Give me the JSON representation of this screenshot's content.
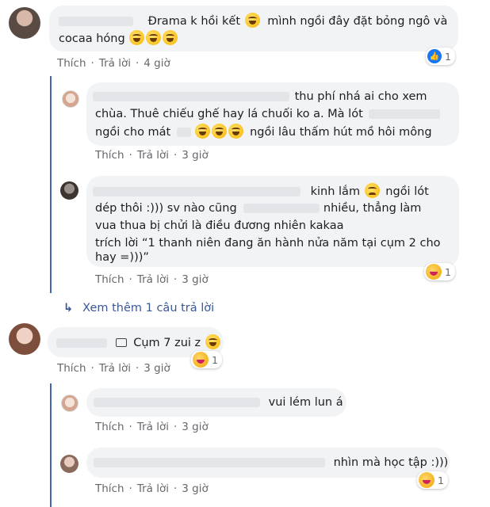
{
  "comments": [
    {
      "id": "c1",
      "lines": [
        "Đrama k hồi kết",
        "mình ngồi đây đặt bỏng ngô và",
        "cocaa hóng"
      ],
      "action_like": "Thích",
      "action_reply": "Trả lời",
      "time": "4 giờ",
      "reaction_count": "1",
      "reaction_icon": "like-icon"
    },
    {
      "id": "c1r1",
      "lines": [
        "thu phí nhá ai cho xem",
        "chùa. Thuê chiếu ghế hay lá chuối ko a. Mà lót",
        "ngồi cho mát",
        "ngồi lâu thấm hút mồ hôi mông"
      ],
      "action_like": "Thích",
      "action_reply": "Trả lời",
      "time": "3 giờ"
    },
    {
      "id": "c1r2",
      "lines": [
        "kinh lắm",
        "ngồi lót",
        "dép thôi :))) sv nào cũng",
        "nhiều, thẳng làm",
        "vua thua bị chửi là điều đương nhiên kakaa",
        "trích lời “1 thanh niên đang ăn hành nửa năm tại cụm 2 cho",
        "hay =)))”"
      ],
      "action_like": "Thích",
      "action_reply": "Trả lời",
      "time": "3 giờ",
      "reaction_count": "1",
      "reaction_icon": "haha-icon"
    },
    {
      "id": "c2",
      "lines": [
        "Cụm 7 zui z"
      ],
      "action_like": "Thích",
      "action_reply": "Trả lời",
      "time": "3 giờ",
      "reaction_count": "1",
      "reaction_icon": "haha-icon"
    },
    {
      "id": "c2r1",
      "lines": [
        "vui lém lun á"
      ],
      "action_like": "Thích",
      "action_reply": "Trả lời",
      "time": "3 giờ"
    },
    {
      "id": "c2r2",
      "lines": [
        "nhìn mà học tập :)))"
      ],
      "action_like": "Thích",
      "action_reply": "Trả lời",
      "time": "3 giờ",
      "reaction_count": "1",
      "reaction_icon": "haha-icon"
    }
  ],
  "see_more": {
    "arrow": "↳",
    "label": "Xem thêm 1 câu trả lời"
  },
  "colors": {
    "bubble": "#f2f3f5",
    "link": "#385898",
    "meta": "#65676b",
    "thread": "#4267b2"
  }
}
